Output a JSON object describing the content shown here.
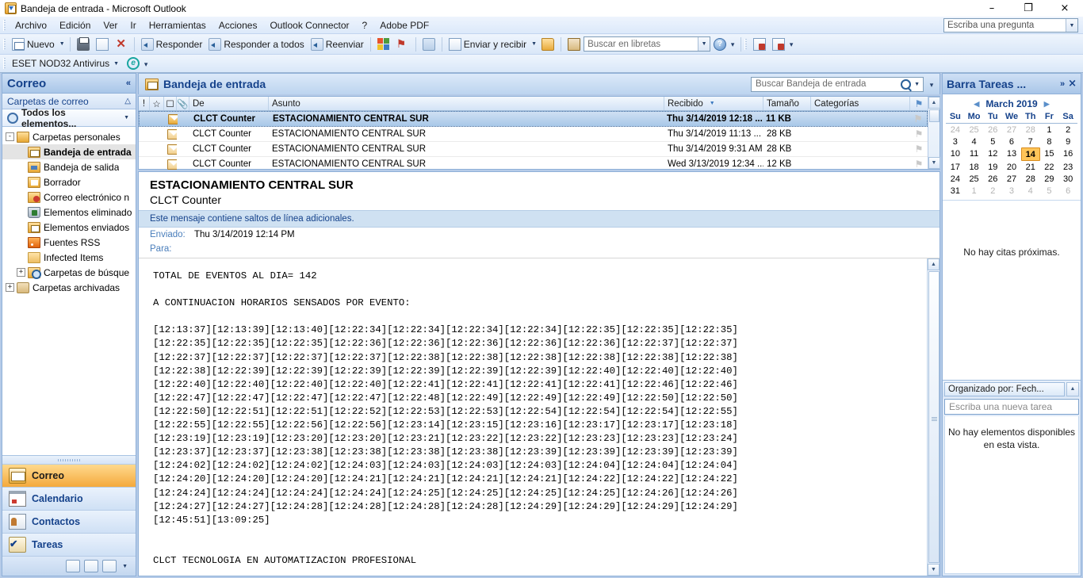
{
  "window": {
    "title": "Bandeja de entrada - Microsoft Outlook",
    "minimize": "–",
    "maximize": "❐",
    "close": "×"
  },
  "menu": {
    "items": [
      "Archivo",
      "Edición",
      "Ver",
      "Ir",
      "Herramientas",
      "Acciones",
      "Outlook Connector",
      "?",
      "Adobe PDF"
    ],
    "ask_placeholder": "Escriba una pregunta"
  },
  "toolbar": {
    "new_label": "Nuevo",
    "reply_label": "Responder",
    "reply_all_label": "Responder a todos",
    "forward_label": "Reenviar",
    "send_receive_label": "Enviar y recibir",
    "address_search_placeholder": "Buscar en libretas",
    "icons": {
      "print": "print-icon",
      "move": "move-to-folder-icon",
      "delete": "delete-icon",
      "categorize": "categorize-icon",
      "flag": "follow-up-flag-icon",
      "rules": "rules-icon",
      "open_folder": "open-folder-icon",
      "address_book": "address-book-icon",
      "help": "help-icon",
      "pdf1": "adobe-pdf-convert-icon",
      "pdf2": "adobe-pdf-mail-icon"
    }
  },
  "toolbar2": {
    "eset_label": "ESET NOD32 Antivirus"
  },
  "navpane": {
    "title": "Correo",
    "section": "Carpetas de correo",
    "filter": "Todos los elementos...",
    "tree": [
      {
        "label": "Carpetas personales",
        "indent": 0,
        "expander": "-",
        "icon": "personal-folders-icon",
        "selected": false
      },
      {
        "label": "Bandeja de entrada",
        "indent": 1,
        "expander": "",
        "icon": "inbox-icon",
        "selected": true
      },
      {
        "label": "Bandeja de salida",
        "indent": 1,
        "expander": "",
        "icon": "outbox-icon",
        "selected": false
      },
      {
        "label": "Borrador",
        "indent": 1,
        "expander": "",
        "icon": "drafts-icon",
        "selected": false
      },
      {
        "label": "Correo electrónico n",
        "indent": 1,
        "expander": "",
        "icon": "junk-mail-icon",
        "selected": false
      },
      {
        "label": "Elementos eliminado",
        "indent": 1,
        "expander": "",
        "icon": "deleted-items-icon",
        "selected": false
      },
      {
        "label": "Elementos enviados",
        "indent": 1,
        "expander": "",
        "icon": "sent-items-icon",
        "selected": false
      },
      {
        "label": "Fuentes RSS",
        "indent": 1,
        "expander": "",
        "icon": "rss-feeds-icon",
        "selected": false
      },
      {
        "label": "Infected Items",
        "indent": 1,
        "expander": "",
        "icon": "folder-icon",
        "selected": false
      },
      {
        "label": "Carpetas de búsque",
        "indent": 1,
        "expander": "+",
        "icon": "search-folders-icon",
        "selected": false
      },
      {
        "label": "Carpetas archivadas",
        "indent": 0,
        "expander": "+",
        "icon": "archive-folders-icon",
        "selected": false
      }
    ],
    "buttons": [
      {
        "label": "Correo",
        "icon": "mail-icon",
        "active": true
      },
      {
        "label": "Calendario",
        "icon": "calendar-icon",
        "active": false
      },
      {
        "label": "Contactos",
        "icon": "contacts-icon",
        "active": false
      },
      {
        "label": "Tareas",
        "icon": "tasks-icon",
        "active": false
      }
    ]
  },
  "inbox": {
    "title": "Bandeja de entrada",
    "search_placeholder": "Buscar Bandeja de entrada",
    "columns": [
      "De",
      "Asunto",
      "Recibido",
      "Tamaño",
      "Categorías"
    ],
    "rows": [
      {
        "from": "CLCT Counter",
        "subject": "ESTACIONAMIENTO CENTRAL SUR",
        "received": "Thu 3/14/2019 12:18 ...",
        "size": "11 KB",
        "selected": true
      },
      {
        "from": "CLCT Counter",
        "subject": "ESTACIONAMIENTO CENTRAL SUR",
        "received": "Thu 3/14/2019 11:13 ...",
        "size": "28 KB",
        "selected": false
      },
      {
        "from": "CLCT Counter",
        "subject": "ESTACIONAMIENTO CENTRAL SUR",
        "received": "Thu 3/14/2019 9:31 AM",
        "size": "28 KB",
        "selected": false
      },
      {
        "from": "CLCT Counter",
        "subject": "ESTACIONAMIENTO CENTRAL SUR",
        "received": "Wed 3/13/2019 12:34 ...",
        "size": "12 KB",
        "selected": false
      }
    ]
  },
  "reading_pane": {
    "subject": "ESTACIONAMIENTO CENTRAL SUR",
    "from": "CLCT Counter",
    "info_bar": "Este mensaje contiene saltos de línea adicionales.",
    "sent_label": "Enviado:",
    "sent_value": "Thu 3/14/2019 12:14 PM",
    "to_label": "Para:",
    "to_value": "",
    "body": "TOTAL DE EVENTOS AL DIA= 142\n\nA CONTINUACION HORARIOS SENSADOS POR EVENTO:\n\n[12:13:37][12:13:39][12:13:40][12:22:34][12:22:34][12:22:34][12:22:34][12:22:35][12:22:35][12:22:35]\n[12:22:35][12:22:35][12:22:35][12:22:36][12:22:36][12:22:36][12:22:36][12:22:36][12:22:37][12:22:37]\n[12:22:37][12:22:37][12:22:37][12:22:37][12:22:38][12:22:38][12:22:38][12:22:38][12:22:38][12:22:38]\n[12:22:38][12:22:39][12:22:39][12:22:39][12:22:39][12:22:39][12:22:39][12:22:40][12:22:40][12:22:40]\n[12:22:40][12:22:40][12:22:40][12:22:40][12:22:41][12:22:41][12:22:41][12:22:41][12:22:46][12:22:46]\n[12:22:47][12:22:47][12:22:47][12:22:47][12:22:48][12:22:49][12:22:49][12:22:49][12:22:50][12:22:50]\n[12:22:50][12:22:51][12:22:51][12:22:52][12:22:53][12:22:53][12:22:54][12:22:54][12:22:54][12:22:55]\n[12:22:55][12:22:55][12:22:56][12:22:56][12:23:14][12:23:15][12:23:16][12:23:17][12:23:17][12:23:18]\n[12:23:19][12:23:19][12:23:20][12:23:20][12:23:21][12:23:22][12:23:22][12:23:23][12:23:23][12:23:24]\n[12:23:37][12:23:37][12:23:38][12:23:38][12:23:38][12:23:38][12:23:39][12:23:39][12:23:39][12:23:39]\n[12:24:02][12:24:02][12:24:02][12:24:03][12:24:03][12:24:03][12:24:03][12:24:04][12:24:04][12:24:04]\n[12:24:20][12:24:20][12:24:20][12:24:21][12:24:21][12:24:21][12:24:21][12:24:22][12:24:22][12:24:22]\n[12:24:24][12:24:24][12:24:24][12:24:24][12:24:25][12:24:25][12:24:25][12:24:25][12:24:26][12:24:26]\n[12:24:27][12:24:27][12:24:28][12:24:28][12:24:28][12:24:28][12:24:29][12:24:29][12:24:29][12:24:29]\n[12:45:51][13:09:25]\n\n\nCLCT TECNOLOGIA EN AUTOMATIZACION PROFESIONAL"
  },
  "todobar": {
    "title": "Barra Tareas ...",
    "expand": "»",
    "close": "×",
    "calendar": {
      "month": "March 2019",
      "prev": "◀",
      "next": "▶",
      "dow": [
        "Su",
        "Mo",
        "Tu",
        "We",
        "Th",
        "Fr",
        "Sa"
      ],
      "weeks": [
        [
          {
            "d": "24",
            "dim": true
          },
          {
            "d": "25",
            "dim": true
          },
          {
            "d": "26",
            "dim": true
          },
          {
            "d": "27",
            "dim": true
          },
          {
            "d": "28",
            "dim": true
          },
          {
            "d": "1",
            "dim": false
          },
          {
            "d": "2",
            "dim": false
          }
        ],
        [
          {
            "d": "3",
            "dim": false
          },
          {
            "d": "4",
            "dim": false
          },
          {
            "d": "5",
            "dim": false
          },
          {
            "d": "6",
            "dim": false
          },
          {
            "d": "7",
            "dim": false
          },
          {
            "d": "8",
            "dim": false
          },
          {
            "d": "9",
            "dim": false
          }
        ],
        [
          {
            "d": "10",
            "dim": false
          },
          {
            "d": "11",
            "dim": false
          },
          {
            "d": "12",
            "dim": false
          },
          {
            "d": "13",
            "dim": false
          },
          {
            "d": "14",
            "dim": false,
            "today": true
          },
          {
            "d": "15",
            "dim": false
          },
          {
            "d": "16",
            "dim": false
          }
        ],
        [
          {
            "d": "17",
            "dim": false
          },
          {
            "d": "18",
            "dim": false
          },
          {
            "d": "19",
            "dim": false
          },
          {
            "d": "20",
            "dim": false
          },
          {
            "d": "21",
            "dim": false
          },
          {
            "d": "22",
            "dim": false
          },
          {
            "d": "23",
            "dim": false
          }
        ],
        [
          {
            "d": "24",
            "dim": false
          },
          {
            "d": "25",
            "dim": false
          },
          {
            "d": "26",
            "dim": false
          },
          {
            "d": "27",
            "dim": false
          },
          {
            "d": "28",
            "dim": false
          },
          {
            "d": "29",
            "dim": false
          },
          {
            "d": "30",
            "dim": false
          }
        ],
        [
          {
            "d": "31",
            "dim": false
          },
          {
            "d": "1",
            "dim": true
          },
          {
            "d": "2",
            "dim": true
          },
          {
            "d": "3",
            "dim": true
          },
          {
            "d": "4",
            "dim": true
          },
          {
            "d": "5",
            "dim": true
          },
          {
            "d": "6",
            "dim": true
          }
        ]
      ]
    },
    "no_appointments": "No hay citas próximas.",
    "group_by": "Organizado por: Fech...",
    "new_task_placeholder": "Escriba una nueva tarea",
    "empty_view": "No hay elementos disponibles en esta vista."
  },
  "colors": {
    "accent": "#15428b",
    "selection": "#a8c8e8",
    "today_highlight": "#ffc559",
    "infobar": "#cfe1f2"
  }
}
